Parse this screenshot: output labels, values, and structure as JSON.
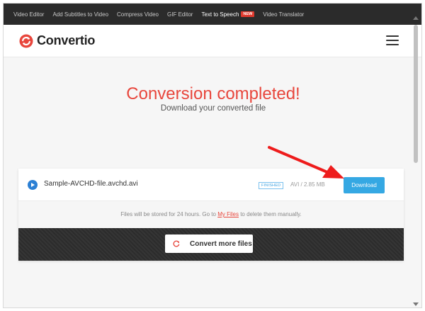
{
  "topnav": {
    "items": [
      {
        "label": "Video Editor"
      },
      {
        "label": "Add Subtitles to Video"
      },
      {
        "label": "Compress Video"
      },
      {
        "label": "GIF Editor"
      },
      {
        "label": "Text to Speech",
        "badge": "NEW"
      },
      {
        "label": "Video Translator"
      }
    ]
  },
  "header": {
    "logo_text": "Convertio",
    "menu_icon": "hamburger-menu-icon"
  },
  "main": {
    "title": "Conversion completed!",
    "subtitle": "Download your converted file"
  },
  "file": {
    "name": "Sample-AVCHD-file.avchd.avi",
    "status": "FINISHED",
    "info": "AVI / 2.85 MB",
    "download_label": "Download",
    "icon": "play-icon"
  },
  "storage_note": {
    "prefix": "Files will be stored for 24 hours. Go to ",
    "link": "My Files",
    "suffix": " to delete them manually."
  },
  "convert_more": {
    "label": "Convert more files",
    "icon": "refresh-icon"
  },
  "colors": {
    "accent_red": "#e8463c",
    "download_blue": "#35a8e3",
    "nav_bg": "#2b2b2b"
  }
}
